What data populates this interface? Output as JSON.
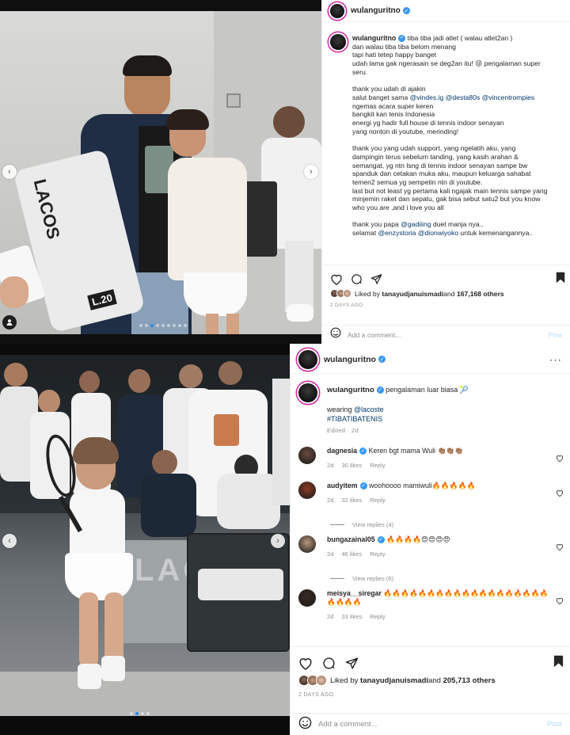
{
  "post1": {
    "username": "wulanguritno",
    "caption_lines": [
      "tiba tiba jadi atlet ( walau atlet2an )",
      "dan walau tiba tiba belom menang",
      "tapi hati tetep happy banget",
      "udah lama gak ngerasain se deg2an itu! 😜 pengalaman super",
      "seru."
    ],
    "thanks_intro": [
      "thank you udah di ajakin",
      "salut banget sama "
    ],
    "mentions_a": [
      "@vindes.ig",
      "@desta80s",
      "@vincentrompies"
    ],
    "thanks_lines": [
      "ngemas acara super keren",
      "bangkit kan tenis Indonesia",
      "energi yg hadir full house di tennis indoor senayan",
      "yang nonton di youtube, merinding!"
    ],
    "support_lines": [
      "thank you yang udah support, yang ngelatih aku, yang",
      "dampingin terus sebelum tanding, yang kasih arahan &",
      "semangat, yg ntn lsng di tennis indoor senayan sampe bw",
      "spanduk dan cetakan muka aku, maupun keluarga sahabat",
      "temen2 semua yg sempetin ntn di youtube.",
      "last but not least yg pertama kali ngajak main tennis sampe yang",
      "minjemin raket dan sepatu, gak bisa sebut satu2 but you know",
      "who you are ,and i love you all"
    ],
    "papa_prefix": "thank you papa ",
    "papa_mention": "@gadiiing",
    "papa_suffix": " duet manja nya..",
    "selamat_prefix": "selamat ",
    "selamat_mentions": [
      "@enzystoria",
      "@dionwiyoko"
    ],
    "selamat_suffix": " untuk kemenangannya..",
    "liked_by_prefix": "Liked by ",
    "liked_by_user": "tanayudjanuismadi",
    "liked_by_mid": " and ",
    "likes_count": "167,168 others",
    "time": "2 DAYS AGO",
    "comment_placeholder": "Add a comment...",
    "post_label": "Post",
    "photo_total": 9,
    "photo_active": 3,
    "shirt_text": "LACOS",
    "bag_text": "L.20"
  },
  "post2": {
    "username": "wulanguritno",
    "caption": "pengalaman luar biasa 🎾",
    "wearing_prefix": "wearing ",
    "wearing_mention": "@lacoste",
    "hashtag": "#TIBATIBATENIS",
    "edited": "Edited · 2d",
    "comments": [
      {
        "user": "dagnesia",
        "verified": true,
        "text": "Keren bgt mama Wuli 👏🏽👏🏽👏🏽",
        "age": "2d",
        "likes": "30 likes",
        "reply": "Reply",
        "avatar_color": "#6b4b3c"
      },
      {
        "user": "audyitem",
        "verified": true,
        "text": "woohoooo mamiwuli🔥🔥🔥🔥🔥",
        "age": "2d",
        "likes": "32 likes",
        "reply": "Reply",
        "avatar_color": "#8a3b28"
      },
      {
        "user": "bungazainal05",
        "verified": true,
        "text": "🔥🔥🔥🔥😍😍😍😍",
        "age": "2d",
        "likes": "46 likes",
        "reply": "Reply",
        "avatar_color": "#b8977c"
      },
      {
        "user": "meisya__siregar",
        "verified": false,
        "text": "🔥🔥🔥🔥🔥🔥🔥🔥🔥🔥🔥🔥🔥🔥🔥🔥🔥🔥🔥🔥🔥🔥🔥",
        "age": "2d",
        "likes": "33 likes",
        "reply": "Reply",
        "avatar_color": "#3a2a22"
      }
    ],
    "view_replies": [
      "View replies (4)",
      "View replies (6)"
    ],
    "liked_by_prefix": "Liked by ",
    "liked_by_user": "tanayudjanuismadi",
    "liked_by_mid": " and ",
    "likes_count": "205,713 others",
    "time": "2 DAYS AGO",
    "comment_placeholder": "Add a comment...",
    "post_label": "Post",
    "photo_total": 4,
    "photo_active": 2,
    "banner_text": "LACOSTE SUSU"
  },
  "colors": {
    "link": "#00376b",
    "verified": "#3897f0",
    "dot_active": "#2d8bf0",
    "story_ring": "#d6249f"
  }
}
